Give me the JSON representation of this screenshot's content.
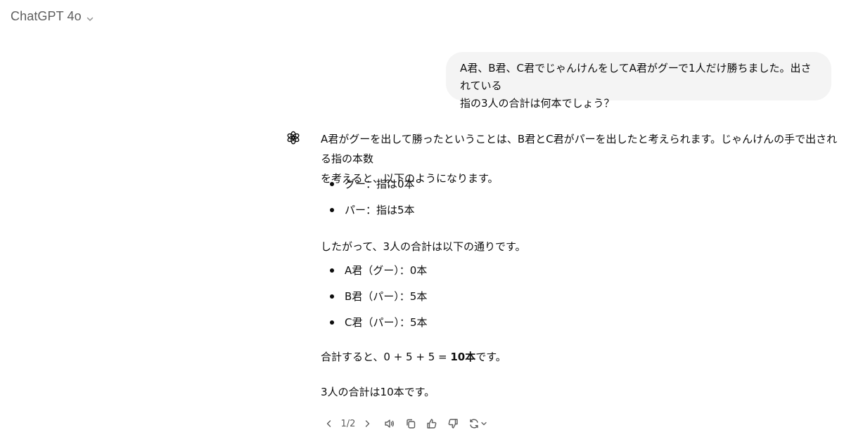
{
  "header": {
    "model_name": "ChatGPT 4o",
    "chevron_icon": "chevron-down-icon"
  },
  "user_message": {
    "line1": "A君、B君、C君でじゃんけんをしてA君がグーで1人だけ勝ちました。出されている",
    "line2": "指の3人の合計は何本でしょう？"
  },
  "assistant_message": {
    "avatar_icon": "openai-logo-icon",
    "intro_line1": "A君がグーを出して勝ったということは、B君とC君がパーを出したと考えられます。じゃんけんの手で出される指の本数",
    "intro_line2": "を考えると、以下のようになります。",
    "list1": [
      "グー：指は0本",
      "パー：指は5本"
    ],
    "para2": "したがって、3人の合計は以下の通りです。",
    "list2": [
      "A君（グー）：0本",
      "B君（パー）：5本",
      "C君（パー）：5本"
    ],
    "sum_prefix": "合計すると、0 + 5 + 5 = ",
    "sum_bold": "10本",
    "sum_suffix": "です。",
    "conclusion": "3人の合計は10本です。"
  },
  "actions": {
    "pager": "1/2",
    "icons": [
      "chevron-left-icon",
      "chevron-right-icon",
      "speaker-icon",
      "copy-icon",
      "thumbs-up-icon",
      "thumbs-down-icon",
      "regenerate-icon",
      "chevron-down-icon"
    ]
  },
  "colors": {
    "bubble_bg": "#f4f4f4",
    "text": "#0d0d0d",
    "muted": "#5d5d5d"
  }
}
